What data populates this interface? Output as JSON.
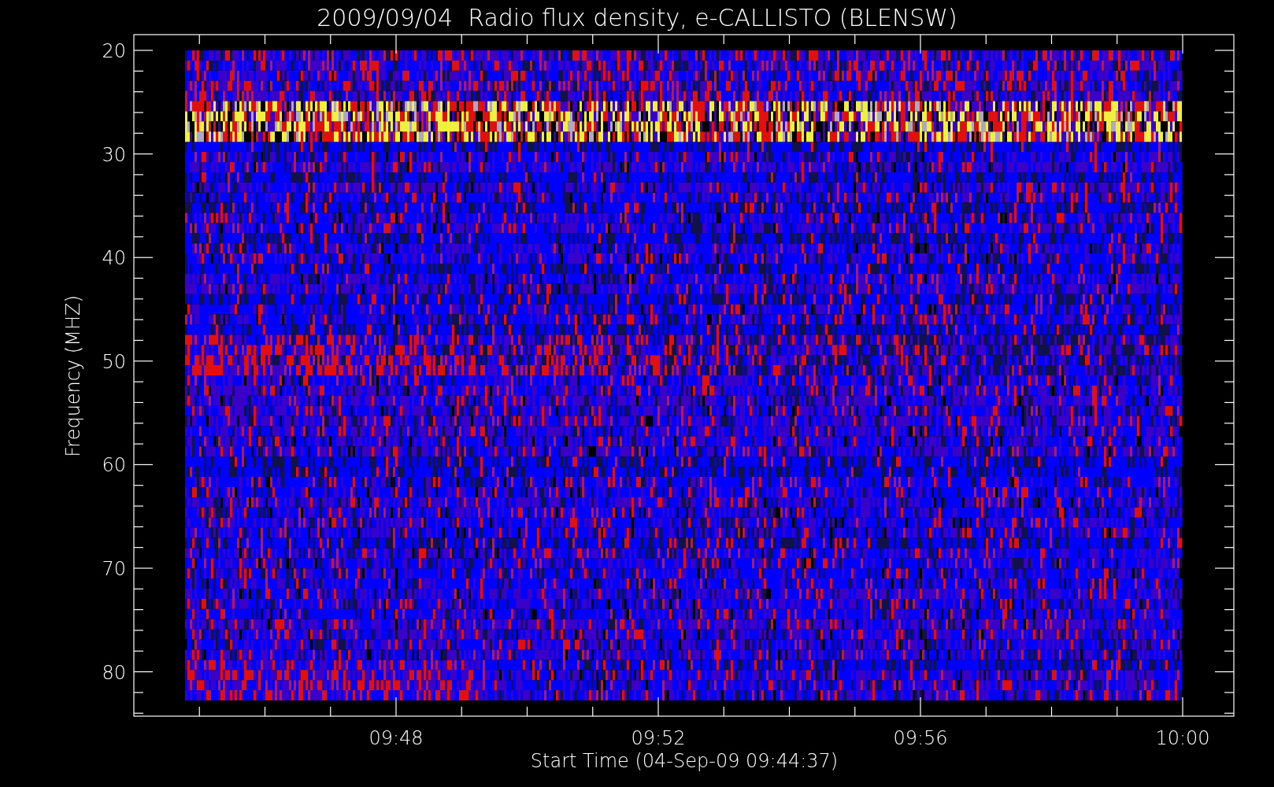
{
  "title": "2009/09/04  Radio flux density, e-CALLISTO (BLENSW)",
  "y_axis": {
    "label": "Frequency (MHZ)",
    "ticks": [
      "20",
      "30",
      "40",
      "50",
      "60",
      "70",
      "80"
    ]
  },
  "x_axis": {
    "label": "Start Time (04-Sep-09 09:44:37)",
    "ticks": [
      "09:48",
      "09:52",
      "09:56",
      "10:00"
    ]
  }
}
